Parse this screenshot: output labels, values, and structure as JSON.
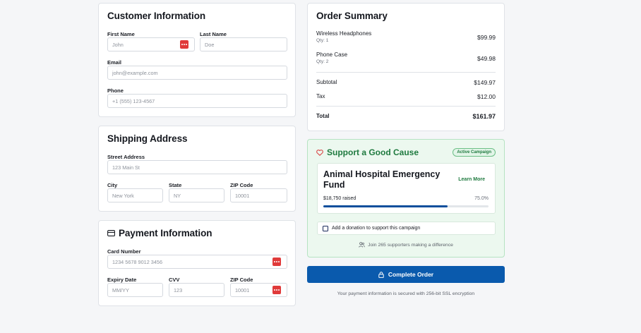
{
  "customer": {
    "title": "Customer Information",
    "first_name_label": "First Name",
    "first_name_placeholder": "John",
    "last_name_label": "Last Name",
    "last_name_placeholder": "Doe",
    "email_label": "Email",
    "email_placeholder": "john@example.com",
    "phone_label": "Phone",
    "phone_placeholder": "+1 (555) 123-4567"
  },
  "shipping": {
    "title": "Shipping Address",
    "street_label": "Street Address",
    "street_placeholder": "123 Main St",
    "city_label": "City",
    "city_placeholder": "New York",
    "state_label": "State",
    "state_placeholder": "NY",
    "zip_label": "ZIP Code",
    "zip_placeholder": "10001"
  },
  "payment": {
    "title": "Payment Information",
    "card_label": "Card Number",
    "card_placeholder": "1234 5678 9012 3456",
    "expiry_label": "Expiry Date",
    "expiry_placeholder": "MM/YY",
    "cvv_label": "CVV",
    "cvv_placeholder": "123",
    "zip_label": "ZIP Code",
    "zip_placeholder": "10001"
  },
  "order": {
    "title": "Order Summary",
    "items": [
      {
        "name": "Wireless Headphones",
        "qty": "Qty: 1",
        "price": "$99.99"
      },
      {
        "name": "Phone Case",
        "qty": "Qty: 2",
        "price": "$49.98"
      }
    ],
    "subtotal_label": "Subtotal",
    "subtotal": "$149.97",
    "tax_label": "Tax",
    "tax": "$12.00",
    "total_label": "Total",
    "total": "$161.97"
  },
  "cause": {
    "title": "Support a Good Cause",
    "badge": "Active Campaign",
    "campaign_name": "Animal Hospital Emergency Fund",
    "learn_more": "Learn More",
    "raised": "$18,750 raised",
    "percent_label": "75.0%",
    "progress": 0.75,
    "donate_label": "Add a donation to support this campaign",
    "supporters": "Join 265 supporters making a difference"
  },
  "actions": {
    "complete_label": "Complete Order",
    "secure_note": "Your payment information is secured with 256-bit SSL encryption"
  },
  "colors": {
    "primary": "#0a5aad",
    "cause_green": "#1f7a3f",
    "cause_bg": "#ecf8ef",
    "password_icon": "#e03a3a"
  }
}
